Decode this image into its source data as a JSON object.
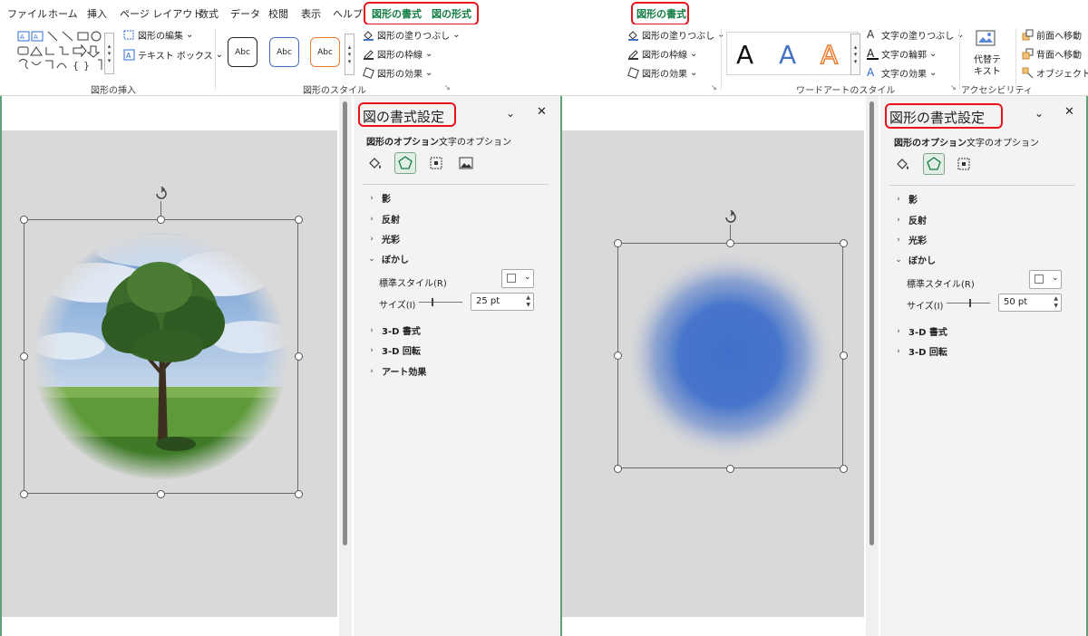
{
  "menu": {
    "items": [
      "ファイル",
      "ホーム",
      "挿入",
      "ページ レイアウト",
      "数式",
      "データ",
      "校閲",
      "表示",
      "ヘルプ"
    ],
    "context_tabs_left": [
      "図形の書式",
      "図の形式"
    ],
    "context_tab_right": "図形の書式"
  },
  "ribbon": {
    "insert_shapes": {
      "label": "図形の挿入",
      "edit_shape": "図形の編集",
      "text_box": "テキスト ボックス"
    },
    "shape_styles": {
      "label": "図形のスタイル",
      "samples": [
        "Abc",
        "Abc",
        "Abc"
      ],
      "fill": "図形の塗りつぶし",
      "outline": "図形の枠線",
      "effects": "図形の効果"
    },
    "right_shape_styles": {
      "fill": "図形の塗りつぶし",
      "outline": "図形の枠線",
      "effects": "図形の効果"
    },
    "wordart": {
      "label": "ワードアートのスタイル",
      "samples": [
        "A",
        "A",
        "A"
      ],
      "text_fill": "文字の塗りつぶし",
      "text_outline": "文字の輪郭",
      "text_effects": "文字の効果"
    },
    "accessibility": {
      "label": "アクセシビリティ",
      "alt_text_line1": "代替テ",
      "alt_text_line2": "キスト"
    },
    "arrange": {
      "bring_forward": "前面へ移動",
      "send_backward": "背面へ移動",
      "selection_pane": "オブジェクトの選"
    }
  },
  "left_pane": {
    "title": "図の書式設定",
    "tab_shape_options": "図形のオプション",
    "tab_text_options": "文字のオプション",
    "sections": [
      "影",
      "反射",
      "光彩",
      "ぼかし"
    ],
    "preset_label": "標準スタイル(R)",
    "size_label": "サイズ(I)",
    "size_value": "25 pt",
    "sections_after": [
      "3-D 書式",
      "3-D 回転",
      "アート効果"
    ]
  },
  "right_pane": {
    "title": "図形の書式設定",
    "tab_shape_options": "図形のオプション",
    "tab_text_options": "文字のオプション",
    "sections": [
      "影",
      "反射",
      "光彩",
      "ぼかし"
    ],
    "preset_label": "標準スタイル(R)",
    "size_label": "サイズ(I)",
    "size_value": "50 pt",
    "sections_after": [
      "3-D 書式",
      "3-D 回転"
    ]
  },
  "colors": {
    "accent_green": "#107c41",
    "highlight_red": "#e8141c",
    "blur_shape_blue": "#3f70c9",
    "wordart_blue": "#4472c4",
    "wordart_orange": "#ed7d31"
  },
  "icons": [
    "fill-bucket-icon",
    "pentagon-effects-icon",
    "size-properties-icon",
    "picture-icon",
    "rotate-icon",
    "alt-text-icon"
  ]
}
